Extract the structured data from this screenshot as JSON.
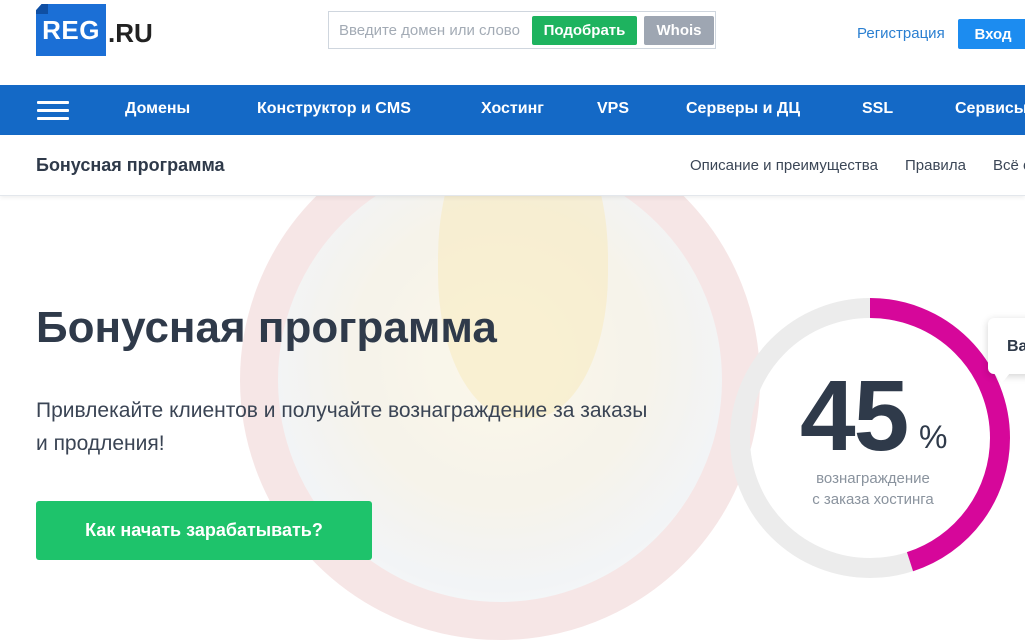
{
  "header": {
    "logo_mark": "REG",
    "logo_suffix": ".RU",
    "search_placeholder": "Введите домен или слово",
    "search_value": "",
    "pick_label": "Подобрать",
    "whois_label": "Whois",
    "register_label": "Регистрация",
    "login_label": "Вход"
  },
  "nav": {
    "menu_icon": "hamburger-icon",
    "items": [
      "Домены",
      "Конструктор и CMS",
      "Хостинг",
      "VPS",
      "Серверы и ДЦ",
      "SSL",
      "Сервисы"
    ]
  },
  "subnav": {
    "title": "Бонусная программа",
    "links": [
      "Описание и преимущества",
      "Правила",
      "Всё о"
    ]
  },
  "hero": {
    "title": "Бонусная программа",
    "text": "Привлекайте клиентов и получайте вознаграждение за заказы и продления!",
    "cta_label": "Как начать зарабатывать?"
  },
  "gauge": {
    "value": "45",
    "percent_sign": "%",
    "progress_fraction": 0.45,
    "caption_line1": "вознаграждение",
    "caption_line2": "с заказа хостинга"
  },
  "tooltip": {
    "text": "Ва"
  },
  "colors": {
    "brand_blue": "#1469c6",
    "green": "#1ec36b",
    "gauge_accent": "#d6079a",
    "gauge_track": "#ececec"
  }
}
